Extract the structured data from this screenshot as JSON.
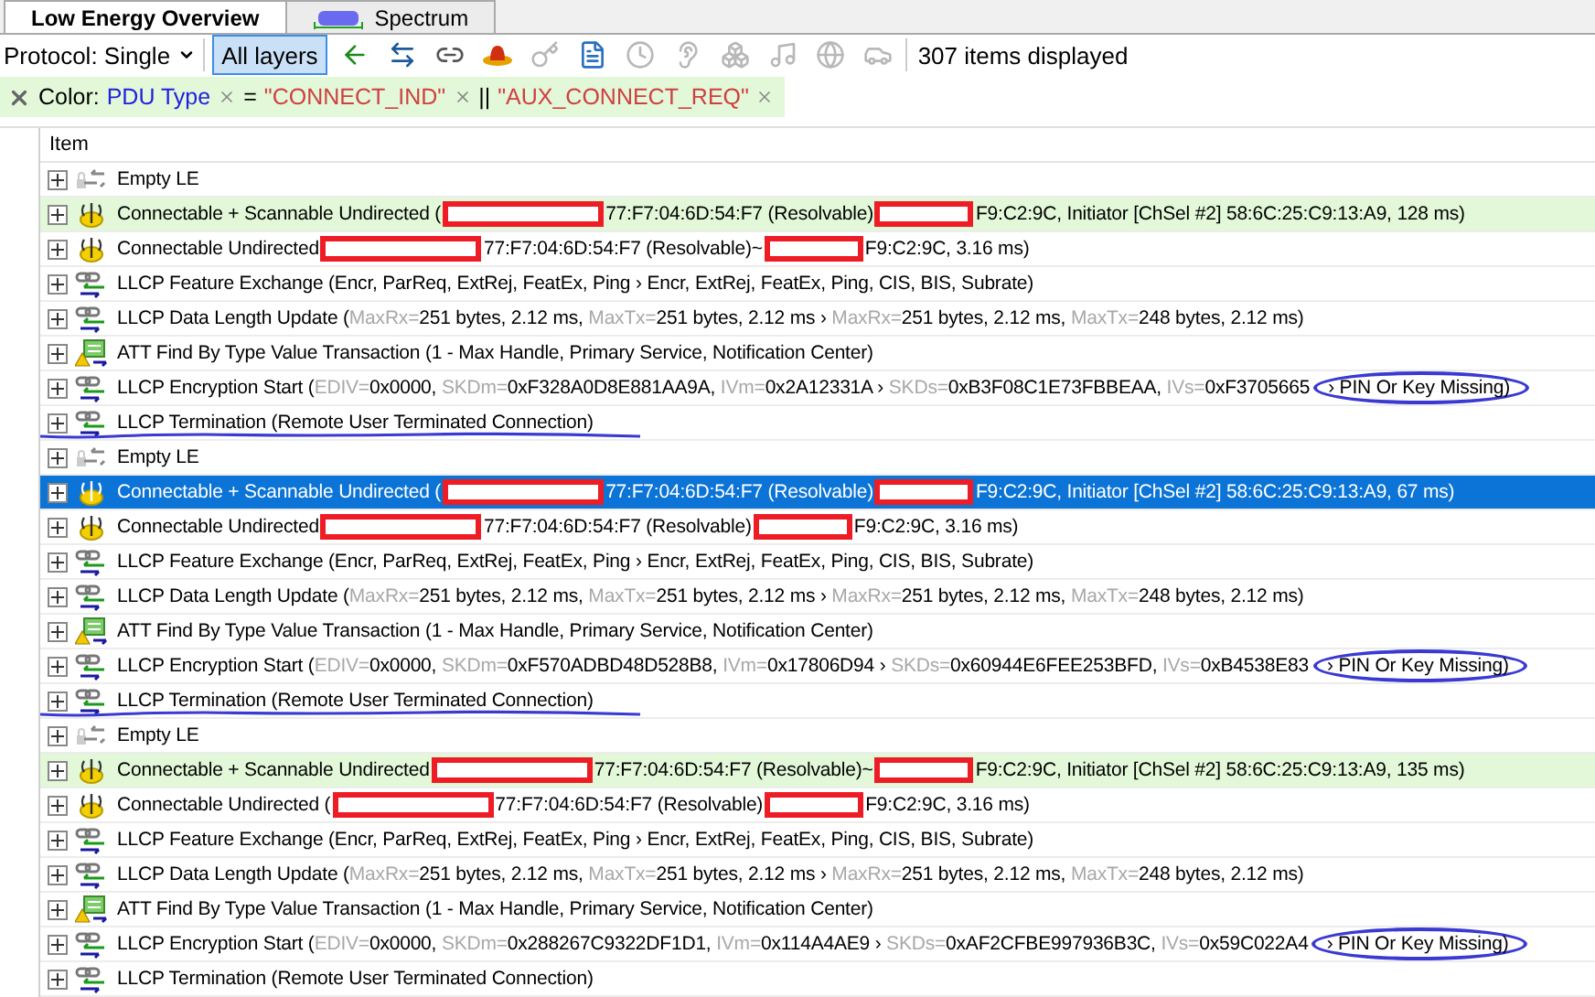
{
  "tabs": [
    {
      "label": "Low Energy Overview",
      "kind": "plain",
      "selected": true
    },
    {
      "label": "Spectrum",
      "kind": "spectrum",
      "selected": false
    }
  ],
  "toolbar": {
    "protocol": "Protocol: Single",
    "layers_button": {
      "label": "All layers",
      "selected": true
    },
    "tools": [
      {
        "kind": "back",
        "disabled": false
      },
      {
        "kind": "both",
        "disabled": false
      },
      {
        "kind": "link",
        "disabled": false
      },
      {
        "kind": "hat",
        "disabled": false
      },
      {
        "kind": "key",
        "disabled": true
      },
      {
        "kind": "doc",
        "disabled": false
      },
      {
        "kind": "clock",
        "disabled": true
      },
      {
        "kind": "ear",
        "disabled": true
      },
      {
        "kind": "boxes",
        "disabled": true
      },
      {
        "kind": "music",
        "disabled": true
      },
      {
        "kind": "globe",
        "disabled": true
      },
      {
        "kind": "car",
        "disabled": true
      }
    ],
    "count": "307 items displayed"
  },
  "filter": {
    "label": "Color:",
    "tokens": [
      {
        "kind": "field",
        "text": "PDU Type",
        "removable": true
      },
      {
        "kind": "operator",
        "text": "=",
        "removable": false
      },
      {
        "kind": "value",
        "text": "\"CONNECT_IND\"",
        "removable": true
      },
      {
        "kind": "operator",
        "text": "||",
        "removable": false
      },
      {
        "kind": "value",
        "text": "\"AUX_CONNECT_REQ\"",
        "removable": true
      }
    ]
  },
  "tree": {
    "column": "Item",
    "rows": [
      {
        "kind": "empty",
        "expanded": false,
        "selected": false,
        "highlighted": false,
        "underlined": false,
        "pieces": [
          {
            "kind": "text",
            "text": "Empty LE"
          }
        ]
      },
      {
        "kind": "adv",
        "expanded": false,
        "selected": false,
        "highlighted": true,
        "underlined": false,
        "pieces": [
          {
            "kind": "text",
            "text": "Connectable + Scannable Undirected ("
          },
          {
            "kind": "redaction"
          },
          {
            "kind": "text",
            "text": "77:F7:04:6D:54:F7 (Resolvable)"
          },
          {
            "kind": "redaction"
          },
          {
            "kind": "text",
            "text": "F9:C2:9C, Initiator [ChSel #2] 58:6C:25:C9:13:A9, 128 ms)"
          }
        ]
      },
      {
        "kind": "adv",
        "expanded": false,
        "selected": false,
        "highlighted": false,
        "underlined": false,
        "pieces": [
          {
            "kind": "text",
            "text": "Connectable Undirected"
          },
          {
            "kind": "redaction"
          },
          {
            "kind": "text",
            "text": "77:F7:04:6D:54:F7 (Resolvable)~"
          },
          {
            "kind": "redaction"
          },
          {
            "kind": "text",
            "text": "F9:C2:9C, 3.16 ms)"
          }
        ]
      },
      {
        "kind": "llcp",
        "expanded": false,
        "selected": false,
        "highlighted": false,
        "underlined": false,
        "pieces": [
          {
            "kind": "text",
            "text": "LLCP Feature Exchange (Encr, ParReq, ExtRej, FeatEx, Ping › Encr, ExtRej, FeatEx, Ping, CIS, BIS, Subrate)"
          }
        ]
      },
      {
        "kind": "llcp",
        "expanded": false,
        "selected": false,
        "highlighted": false,
        "underlined": false,
        "pieces": [
          {
            "kind": "text",
            "text": "LLCP Data Length Update ("
          },
          {
            "kind": "field",
            "text": "MaxRx="
          },
          {
            "kind": "text",
            "text": "251 bytes, 2.12 ms, "
          },
          {
            "kind": "field",
            "text": "MaxTx="
          },
          {
            "kind": "text",
            "text": "251 bytes, 2.12 ms › "
          },
          {
            "kind": "field",
            "text": "MaxRx="
          },
          {
            "kind": "text",
            "text": "251 bytes, 2.12 ms, "
          },
          {
            "kind": "field",
            "text": "MaxTx="
          },
          {
            "kind": "text",
            "text": "248 bytes, 2.12 ms)"
          }
        ]
      },
      {
        "kind": "att",
        "expanded": false,
        "selected": false,
        "highlighted": false,
        "underlined": false,
        "pieces": [
          {
            "kind": "text",
            "text": "ATT Find By Type Value Transaction (1 - Max Handle, Primary Service, Notification Center)"
          }
        ]
      },
      {
        "kind": "llcp",
        "expanded": false,
        "selected": false,
        "highlighted": false,
        "underlined": false,
        "pieces": [
          {
            "kind": "text",
            "text": "LLCP Encryption Start ("
          },
          {
            "kind": "field",
            "text": "EDIV="
          },
          {
            "kind": "text",
            "text": "0x0000, "
          },
          {
            "kind": "field",
            "text": "SKDm="
          },
          {
            "kind": "text",
            "text": "0xF328A0D8E881AA9A, "
          },
          {
            "kind": "field",
            "text": "IVm="
          },
          {
            "kind": "text",
            "text": "0x2A12331A › "
          },
          {
            "kind": "field",
            "text": "SKDs="
          },
          {
            "kind": "text",
            "text": "0xB3F08C1E73FBBEAA, "
          },
          {
            "kind": "field",
            "text": "IVs="
          },
          {
            "kind": "text",
            "text": "0xF3705665"
          },
          {
            "kind": "circled",
            "text": "› PIN Or Key Missing)"
          }
        ]
      },
      {
        "kind": "llcp",
        "expanded": false,
        "selected": false,
        "highlighted": false,
        "underlined": true,
        "pieces": [
          {
            "kind": "text",
            "text": "LLCP Termination (Remote User Terminated Connection)"
          }
        ]
      },
      {
        "kind": "empty",
        "expanded": false,
        "selected": false,
        "highlighted": false,
        "underlined": false,
        "pieces": [
          {
            "kind": "text",
            "text": "Empty LE"
          }
        ]
      },
      {
        "kind": "adv",
        "expanded": false,
        "selected": true,
        "highlighted": true,
        "underlined": false,
        "pieces": [
          {
            "kind": "text",
            "text": "Connectable + Scannable Undirected ("
          },
          {
            "kind": "redaction"
          },
          {
            "kind": "text",
            "text": "77:F7:04:6D:54:F7 (Resolvable)"
          },
          {
            "kind": "redaction"
          },
          {
            "kind": "text",
            "text": "F9:C2:9C, Initiator [ChSel #2] 58:6C:25:C9:13:A9, 67 ms)"
          }
        ]
      },
      {
        "kind": "adv",
        "expanded": false,
        "selected": false,
        "highlighted": false,
        "underlined": false,
        "pieces": [
          {
            "kind": "text",
            "text": "Connectable Undirected"
          },
          {
            "kind": "redaction"
          },
          {
            "kind": "text",
            "text": "77:F7:04:6D:54:F7 (Resolvable)"
          },
          {
            "kind": "redaction"
          },
          {
            "kind": "text",
            "text": "F9:C2:9C, 3.16 ms)"
          }
        ]
      },
      {
        "kind": "llcp",
        "expanded": false,
        "selected": false,
        "highlighted": false,
        "underlined": false,
        "pieces": [
          {
            "kind": "text",
            "text": "LLCP Feature Exchange (Encr, ParReq, ExtRej, FeatEx, Ping › Encr, ExtRej, FeatEx, Ping, CIS, BIS, Subrate)"
          }
        ]
      },
      {
        "kind": "llcp",
        "expanded": false,
        "selected": false,
        "highlighted": false,
        "underlined": false,
        "pieces": [
          {
            "kind": "text",
            "text": "LLCP Data Length Update ("
          },
          {
            "kind": "field",
            "text": "MaxRx="
          },
          {
            "kind": "text",
            "text": "251 bytes, 2.12 ms, "
          },
          {
            "kind": "field",
            "text": "MaxTx="
          },
          {
            "kind": "text",
            "text": "251 bytes, 2.12 ms › "
          },
          {
            "kind": "field",
            "text": "MaxRx="
          },
          {
            "kind": "text",
            "text": "251 bytes, 2.12 ms, "
          },
          {
            "kind": "field",
            "text": "MaxTx="
          },
          {
            "kind": "text",
            "text": "248 bytes, 2.12 ms)"
          }
        ]
      },
      {
        "kind": "att",
        "expanded": false,
        "selected": false,
        "highlighted": false,
        "underlined": false,
        "pieces": [
          {
            "kind": "text",
            "text": "ATT Find By Type Value Transaction (1 - Max Handle, Primary Service, Notification Center)"
          }
        ]
      },
      {
        "kind": "llcp",
        "expanded": false,
        "selected": false,
        "highlighted": false,
        "underlined": false,
        "pieces": [
          {
            "kind": "text",
            "text": "LLCP Encryption Start ("
          },
          {
            "kind": "field",
            "text": "EDIV="
          },
          {
            "kind": "text",
            "text": "0x0000, "
          },
          {
            "kind": "field",
            "text": "SKDm="
          },
          {
            "kind": "text",
            "text": "0xF570ADBD48D528B8, "
          },
          {
            "kind": "field",
            "text": "IVm="
          },
          {
            "kind": "text",
            "text": "0x17806D94 › "
          },
          {
            "kind": "field",
            "text": "SKDs="
          },
          {
            "kind": "text",
            "text": "0x60944E6FEE253BFD, "
          },
          {
            "kind": "field",
            "text": "IVs="
          },
          {
            "kind": "text",
            "text": "0xB4538E83"
          },
          {
            "kind": "circled",
            "text": "› PIN Or Key Missing)"
          }
        ]
      },
      {
        "kind": "llcp",
        "expanded": false,
        "selected": false,
        "highlighted": false,
        "underlined": true,
        "pieces": [
          {
            "kind": "text",
            "text": "LLCP Termination (Remote User Terminated Connection)"
          }
        ]
      },
      {
        "kind": "empty",
        "expanded": false,
        "selected": false,
        "highlighted": false,
        "underlined": false,
        "pieces": [
          {
            "kind": "text",
            "text": "Empty LE"
          }
        ]
      },
      {
        "kind": "adv",
        "expanded": false,
        "selected": false,
        "highlighted": true,
        "underlined": false,
        "pieces": [
          {
            "kind": "text",
            "text": "Connectable + Scannable Undirected"
          },
          {
            "kind": "redaction"
          },
          {
            "kind": "text",
            "text": "77:F7:04:6D:54:F7 (Resolvable)~"
          },
          {
            "kind": "redaction"
          },
          {
            "kind": "text",
            "text": "F9:C2:9C, Initiator [ChSel #2] 58:6C:25:C9:13:A9, 135 ms)"
          }
        ]
      },
      {
        "kind": "adv",
        "expanded": false,
        "selected": false,
        "highlighted": false,
        "underlined": false,
        "pieces": [
          {
            "kind": "text",
            "text": "Connectable Undirected ("
          },
          {
            "kind": "redaction"
          },
          {
            "kind": "text",
            "text": "77:F7:04:6D:54:F7 (Resolvable)"
          },
          {
            "kind": "redaction"
          },
          {
            "kind": "text",
            "text": "F9:C2:9C, 3.16 ms)"
          }
        ]
      },
      {
        "kind": "llcp",
        "expanded": false,
        "selected": false,
        "highlighted": false,
        "underlined": false,
        "pieces": [
          {
            "kind": "text",
            "text": "LLCP Feature Exchange (Encr, ParReq, ExtRej, FeatEx, Ping › Encr, ExtRej, FeatEx, Ping, CIS, BIS, Subrate)"
          }
        ]
      },
      {
        "kind": "llcp",
        "expanded": false,
        "selected": false,
        "highlighted": false,
        "underlined": false,
        "pieces": [
          {
            "kind": "text",
            "text": "LLCP Data Length Update ("
          },
          {
            "kind": "field",
            "text": "MaxRx="
          },
          {
            "kind": "text",
            "text": "251 bytes, 2.12 ms, "
          },
          {
            "kind": "field",
            "text": "MaxTx="
          },
          {
            "kind": "text",
            "text": "251 bytes, 2.12 ms › "
          },
          {
            "kind": "field",
            "text": "MaxRx="
          },
          {
            "kind": "text",
            "text": "251 bytes, 2.12 ms, "
          },
          {
            "kind": "field",
            "text": "MaxTx="
          },
          {
            "kind": "text",
            "text": "248 bytes, 2.12 ms)"
          }
        ]
      },
      {
        "kind": "att",
        "expanded": false,
        "selected": false,
        "highlighted": false,
        "underlined": false,
        "pieces": [
          {
            "kind": "text",
            "text": "ATT Find By Type Value Transaction (1 - Max Handle, Primary Service, Notification Center)"
          }
        ]
      },
      {
        "kind": "llcp",
        "expanded": false,
        "selected": false,
        "highlighted": false,
        "underlined": false,
        "pieces": [
          {
            "kind": "text",
            "text": "LLCP Encryption Start ("
          },
          {
            "kind": "field",
            "text": "EDIV="
          },
          {
            "kind": "text",
            "text": "0x0000, "
          },
          {
            "kind": "field",
            "text": "SKDm="
          },
          {
            "kind": "text",
            "text": "0x288267C9322DF1D1, "
          },
          {
            "kind": "field",
            "text": "IVm="
          },
          {
            "kind": "text",
            "text": "0x114A4AE9 › "
          },
          {
            "kind": "field",
            "text": "SKDs="
          },
          {
            "kind": "text",
            "text": "0xAF2CFBE997936B3C, "
          },
          {
            "kind": "field",
            "text": "IVs="
          },
          {
            "kind": "text",
            "text": "0x59C022A4"
          },
          {
            "kind": "circled",
            "text": "› PIN Or Key Missing)"
          }
        ]
      },
      {
        "kind": "llcp",
        "expanded": false,
        "selected": false,
        "highlighted": false,
        "underlined": false,
        "pieces": [
          {
            "kind": "text",
            "text": "LLCP Termination (Remote User Terminated Connection)"
          }
        ]
      }
    ]
  }
}
